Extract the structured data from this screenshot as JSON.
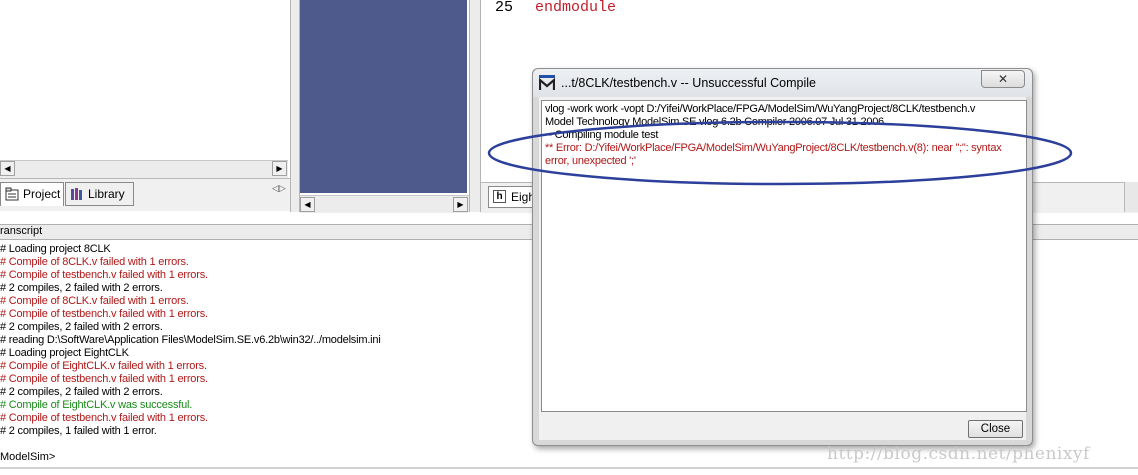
{
  "project_tabs": [
    {
      "label": "Project",
      "icon": "project-icon"
    },
    {
      "label": "Library",
      "icon": "library-icon"
    }
  ],
  "editor": {
    "line_number": "25",
    "code": "endmodule",
    "tab_label": "Eigh",
    "code_color": "#c0202a"
  },
  "transcript": {
    "title": "ranscript",
    "lines": [
      {
        "text": "# Loading project 8CLK",
        "kind": "info"
      },
      {
        "text": "# Compile of 8CLK.v failed with 1 errors.",
        "kind": "error"
      },
      {
        "text": "# Compile of testbench.v failed with 1 errors.",
        "kind": "error"
      },
      {
        "text": "# 2 compiles, 2 failed with 2 errors.",
        "kind": "info"
      },
      {
        "text": "# Compile of 8CLK.v failed with 1 errors.",
        "kind": "error"
      },
      {
        "text": "# Compile of testbench.v failed with 1 errors.",
        "kind": "error"
      },
      {
        "text": "# 2 compiles, 2 failed with 2 errors.",
        "kind": "info"
      },
      {
        "text": "# reading D:\\SoftWare\\Application Files\\ModelSim.SE.v6.2b\\win32/../modelsim.ini",
        "kind": "info"
      },
      {
        "text": "# Loading project EightCLK",
        "kind": "info"
      },
      {
        "text": "# Compile of EightCLK.v failed with 1 errors.",
        "kind": "error"
      },
      {
        "text": "# Compile of testbench.v failed with 1 errors.",
        "kind": "error"
      },
      {
        "text": "# 2 compiles, 2 failed with 2 errors.",
        "kind": "info"
      },
      {
        "text": "# Compile of EightCLK.v was successful.",
        "kind": "success"
      },
      {
        "text": "# Compile of testbench.v failed with 1 errors.",
        "kind": "error"
      },
      {
        "text": "# 2 compiles, 1 failed with 1 error.",
        "kind": "info"
      }
    ],
    "prompt": "ModelSim>",
    "colors": {
      "info": "#000000",
      "error": "#b01818",
      "success": "#1a8a1a"
    }
  },
  "dialog": {
    "title": "...t/8CLK/testbench.v  -- Unsuccessful Compile",
    "close_x": "✕",
    "close_button": "Close",
    "lines": [
      {
        "text": "vlog -work work -vopt D:/Yifei/WorkPlace/FPGA/ModelSim/WuYangProject/8CLK/testbench.v",
        "kind": "info"
      },
      {
        "text": "Model Technology ModelSim SE vlog 6.2b Compiler 2006.07 Jul 31 2006",
        "kind": "info"
      },
      {
        "text": "-- Compiling module test",
        "kind": "info"
      },
      {
        "text": "** Error: D:/Yifei/WorkPlace/FPGA/ModelSim/WuYangProject/8CLK/testbench.v(8): near \";\": syntax",
        "kind": "error"
      },
      {
        "text": "error, unexpected ';'",
        "kind": "error"
      }
    ]
  },
  "annotation_color": "#2c3f9a",
  "watermark": "http://blog.csdn.net/phenixyf"
}
